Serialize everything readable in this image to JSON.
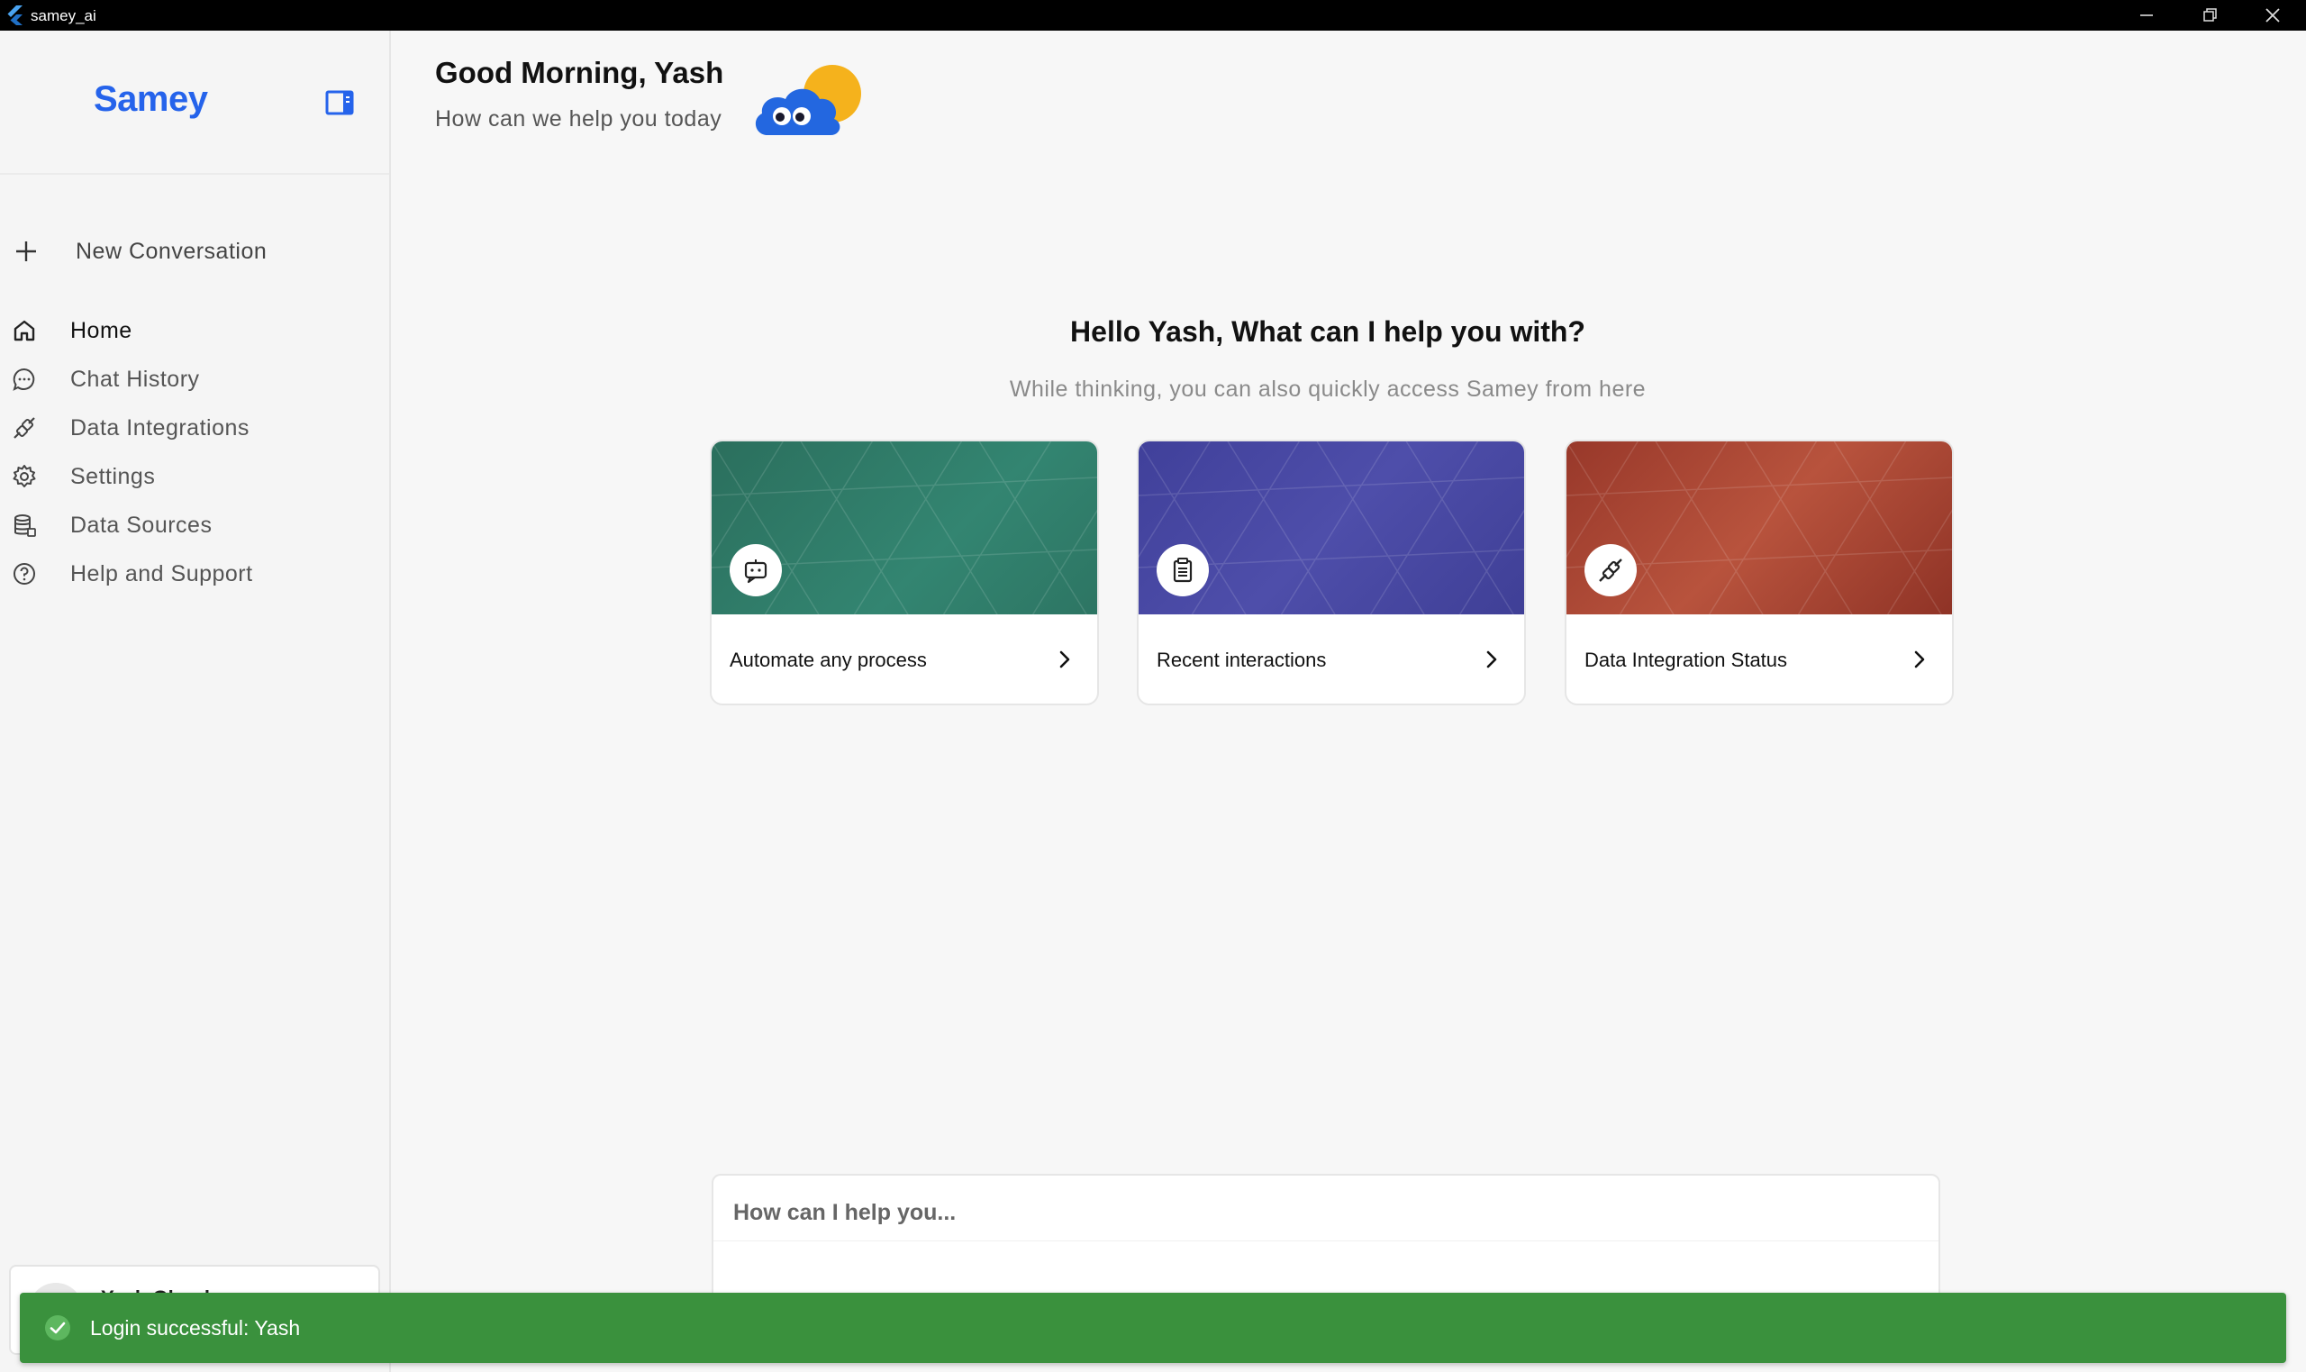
{
  "window": {
    "title": "samey_ai",
    "controls": [
      "minimize",
      "restore",
      "close"
    ]
  },
  "sidebar": {
    "logo": "Samey",
    "new_conversation": "New Conversation",
    "items": [
      {
        "label": "Home",
        "icon": "home-icon",
        "active": true
      },
      {
        "label": "Chat History",
        "icon": "chat-bubble-icon",
        "active": false
      },
      {
        "label": "Data Integrations",
        "icon": "plug-icon",
        "active": false
      },
      {
        "label": "Settings",
        "icon": "gear-icon",
        "active": false
      },
      {
        "label": "Data Sources",
        "icon": "database-icon",
        "active": false
      },
      {
        "label": "Help and Support",
        "icon": "help-circle-icon",
        "active": false
      }
    ],
    "user_name": "Yash Ghugl"
  },
  "header": {
    "greeting": "Good Morning, Yash",
    "subtitle": "How can we help you today"
  },
  "hero": {
    "title": "Hello Yash, What can I help you with?",
    "subtitle": "While thinking, you can also quickly access Samey from here"
  },
  "cards": [
    {
      "label": "Automate any process",
      "icon": "bot-chat-icon",
      "color": "#2e7a66"
    },
    {
      "label": "Recent interactions",
      "icon": "clipboard-icon",
      "color": "#4a4aa6"
    },
    {
      "label": "Data Integration Status",
      "icon": "plug-icon",
      "color": "#a4412f"
    }
  ],
  "composer": {
    "placeholder": "How can I help you..."
  },
  "toast": {
    "message": "Login successful: Yash",
    "color": "#3a913d"
  },
  "colors": {
    "brand": "#2563eb"
  }
}
